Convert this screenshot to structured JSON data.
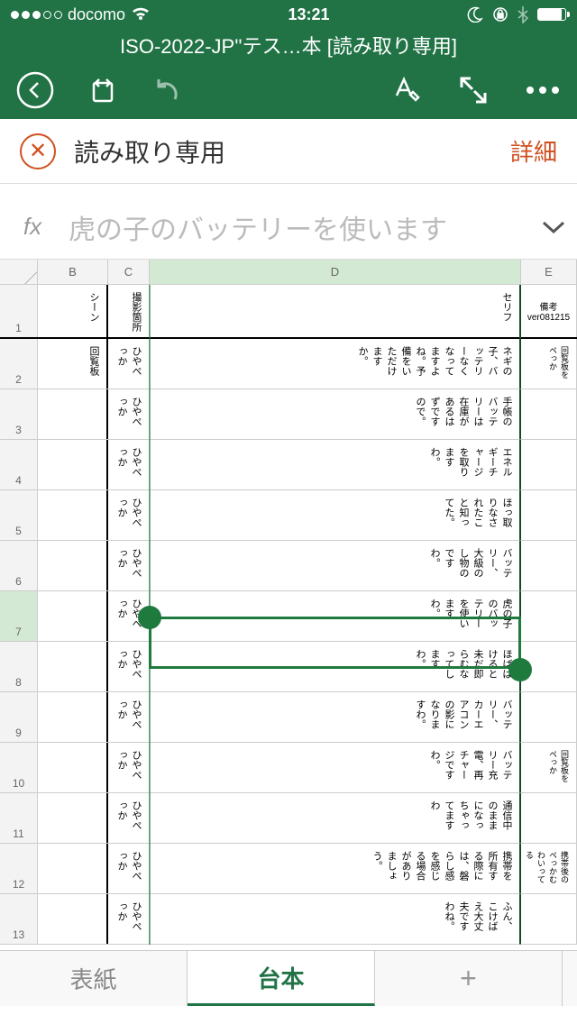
{
  "status": {
    "carrier": "docomo",
    "time": "13:21"
  },
  "title": "ISO-2022-JP''テス…本 [読み取り専用]",
  "banner": {
    "text": "読み取り専用",
    "link": "詳細"
  },
  "formula": {
    "fx": "fx",
    "text": "虎の子のバッテリーを使います"
  },
  "columns": {
    "b": "B",
    "c": "C",
    "d": "D",
    "e": "E"
  },
  "rows": [
    "1",
    "2",
    "3",
    "4",
    "5",
    "6",
    "7",
    "8",
    "9",
    "10",
    "11",
    "12",
    "13"
  ],
  "cells": {
    "b1": "シーン",
    "c1": "撮影箇所",
    "d1": "セリフ",
    "e1": "備考\nver081215",
    "b2": "回覧板",
    "c2": "ひやぺっか",
    "d2": "ネギの子、バッテリーなくなってますよね。予備をいただけますか。",
    "e2": "回覧板をペっか",
    "c3": "ひやぺっか",
    "d3": "手帳のバッテリーは在庫があるはずですので。",
    "c4": "ひやぺっか",
    "d4": "エネルギーチャージを取りますわ。",
    "c5": "ひやぺっか",
    "d5": "ほっ取りなされたこと知ってた。",
    "c6": "ひやぺっか",
    "d6": "バッテリー、大級のし物のですわ。",
    "c7": "ひやぺっか",
    "d7": "虎の子のバッテリーを使いますわ。",
    "c8": "ひやぺっか",
    "d8": "ほばばけると未だ即らむなってしますわ。",
    "c9": "ひやぺっか",
    "d9": "バッテリー、カーエアコンの影になりますわ。",
    "c10": "ひやぺっか",
    "d10": "バッテリー充電、再チャージですわ。",
    "e10": "回覧板をペっか",
    "c11": "ひやぺっか",
    "d11": "通信中のままになっちゃってますわ",
    "c12": "ひやぺっか",
    "d12": "携帯を所有する際には、磐らし感を感じる場合がありましょう。",
    "e12": "携帯後のペっかむわいってる",
    "c13": "ひやぺっか",
    "d13": "ふん、こけばえ大丈夫ですわね。"
  },
  "tabs": {
    "t1": "表紙",
    "t2": "台本",
    "add": "+"
  }
}
